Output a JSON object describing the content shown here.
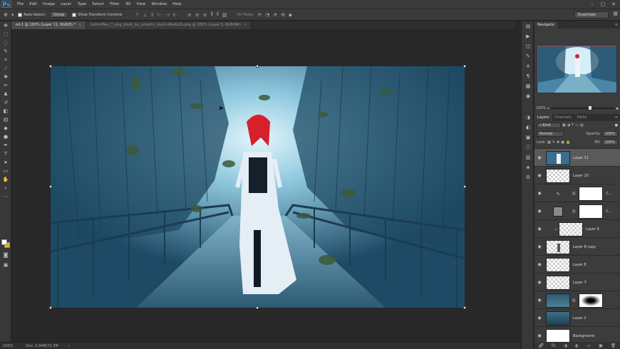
{
  "app": {
    "logo": "Ps"
  },
  "menu": [
    "File",
    "Edit",
    "Image",
    "Layer",
    "Type",
    "Select",
    "Filter",
    "3D",
    "View",
    "Window",
    "Help"
  ],
  "window_controls": [
    "–",
    "▢",
    "✕"
  ],
  "options": {
    "auto_select_label": "Auto-Select:",
    "auto_select_value": "Group",
    "transform_label": "Show Transform Controls",
    "mode_3d": "3D Mode:",
    "workspace": "Essentials"
  },
  "doc_tabs": [
    {
      "label": "od-1 @ 100% (Layer 11, RGB/8) *",
      "active": true
    },
    {
      "label": "butterflies_7_png_stock_by_jumpinc_stock-d6a4b2b.png @ 100% (Layer 0, RGB/8#)",
      "active": false
    }
  ],
  "status": {
    "zoom": "100%",
    "doc": "Doc: 2.44M/72.3M"
  },
  "navigator": {
    "tab": "Navigator",
    "zoom": "100%"
  },
  "layers_panel": {
    "tabs": [
      "Layers",
      "Channels",
      "Paths"
    ],
    "filter": "Kind",
    "blend_mode": "Normal",
    "opacity_label": "Opacity:",
    "opacity_value": "100%",
    "lock_label": "Lock:",
    "fill_label": "Fill:",
    "fill_value": "100%",
    "layers": [
      {
        "name": "Layer 11",
        "thumb": "photo",
        "mask": false,
        "selected": true
      },
      {
        "name": "Layer 10",
        "thumb": "transparent",
        "mask": false,
        "selected": false
      },
      {
        "name": "C...",
        "thumb": "adjustment-curves",
        "mask": true,
        "selected": false
      },
      {
        "name": "C...",
        "thumb": "adjustment-solid",
        "mask": true,
        "selected": false
      },
      {
        "name": "Layer 9",
        "thumb": "transparent",
        "mask": false,
        "selected": false
      },
      {
        "name": "Layer 8 copy",
        "thumb": "transparent",
        "mask": false,
        "selected": false
      },
      {
        "name": "Layer 8",
        "thumb": "transparent",
        "mask": false,
        "selected": false
      },
      {
        "name": "Layer 7",
        "thumb": "transparent",
        "mask": false,
        "selected": false
      },
      {
        "name": "",
        "thumb": "photo-dark",
        "mask": true,
        "selected": false
      },
      {
        "name": "Layer 2",
        "thumb": "photo-dark",
        "mask": false,
        "selected": false
      },
      {
        "name": "Background",
        "thumb": "white",
        "mask": false,
        "selected": false
      }
    ],
    "footer": [
      "🔗",
      "fx",
      "◑",
      "◐",
      "▭",
      "▣",
      "🗑"
    ]
  },
  "colors": {
    "foreground": "#ffffff",
    "background": "#f2b400",
    "nav_frame": "#e03030"
  }
}
